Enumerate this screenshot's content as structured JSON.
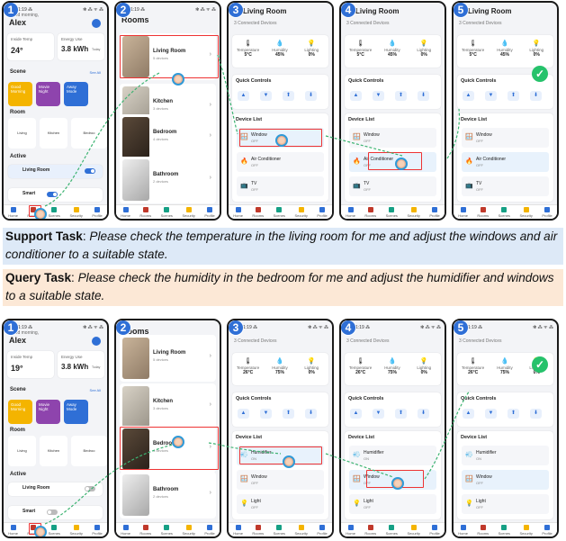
{
  "tasks": {
    "support_label": "Support Task",
    "support_text": "Please check the temperature in the living room for me and adjust the windows and air conditioner to a suitable state.",
    "query_label": "Query Task",
    "query_text": "Please check the humidity in the bedroom for me and adjust the humidifier and windows to a suitable state."
  },
  "common": {
    "status_time": "1:19 ⁂",
    "status_right": "✻ ⁂ ᯤ ⁂",
    "greeting": "Good morning,",
    "user": "Alex",
    "rooms_title": "Rooms",
    "see_all": "See All",
    "scene_label": "Scene",
    "room_label": "Room",
    "active_label": "Active",
    "inside_temp_label": "Inside Temp",
    "energy_label": "Energy Use",
    "energy_value": "3.8 kWh",
    "energy_unit": "Today",
    "connected_devices": "3 Connected Devices",
    "room_header": "Living Room",
    "quick_controls": "Quick Controls",
    "device_list": "Device List",
    "temperature_label": "Temperature",
    "humidity_label": "Humidity",
    "lighting_label": "Lighting",
    "scenes": [
      "Good Morning",
      "Movie Night",
      "Away Mode"
    ],
    "room_cards": [
      {
        "name": "Living",
        "sub": "3 of 5 devices active"
      },
      {
        "name": "Kitchen",
        "sub": "2 of 3 devices active"
      },
      {
        "name": "Bedroo",
        "sub": "1 of 3 devi"
      }
    ],
    "rooms": [
      {
        "name": "Living Room",
        "count": "5 devices"
      },
      {
        "name": "Kitchen",
        "count": "3 devices"
      },
      {
        "name": "Bedroom",
        "count": "4 devices"
      },
      {
        "name": "Bathroom",
        "count": "2 devices"
      }
    ],
    "nav": [
      "Home",
      "Rooms",
      "Scenes",
      "Security",
      "Profile"
    ]
  },
  "top": {
    "inside_temp": "24°",
    "env": {
      "temperature": "5°C",
      "humidity": "45%",
      "lighting": "0%"
    },
    "active_items": [
      {
        "name": "Living Room",
        "sub": "Living Room"
      },
      {
        "name": "Smart",
        "sub": "Living Room"
      }
    ],
    "devices": [
      {
        "name": "Window",
        "state": "OFF"
      },
      {
        "name": "Air Conditioner",
        "state": "OFF"
      },
      {
        "name": "TV",
        "state": "OFF"
      }
    ]
  },
  "bottom": {
    "inside_temp": "19°",
    "env": {
      "temperature": "26°C",
      "humidity": "75%",
      "lighting": "0%"
    },
    "active_items": [
      {
        "name": "Living Room",
        "sub": "Living Room"
      },
      {
        "name": "Smart",
        "sub": "Living Room"
      }
    ],
    "devices": [
      {
        "name": "Humidifier",
        "state": "ON"
      },
      {
        "name": "Window",
        "state": "OFF"
      },
      {
        "name": "Light",
        "state": "OFF"
      }
    ]
  },
  "steps": [
    "1",
    "2",
    "3",
    "4",
    "5"
  ],
  "colors": {
    "accent": "#2f6fd6",
    "highlight": "#e33333",
    "support_bg": "#dde9f7",
    "query_bg": "#fce8d6",
    "check": "#26c26b"
  }
}
